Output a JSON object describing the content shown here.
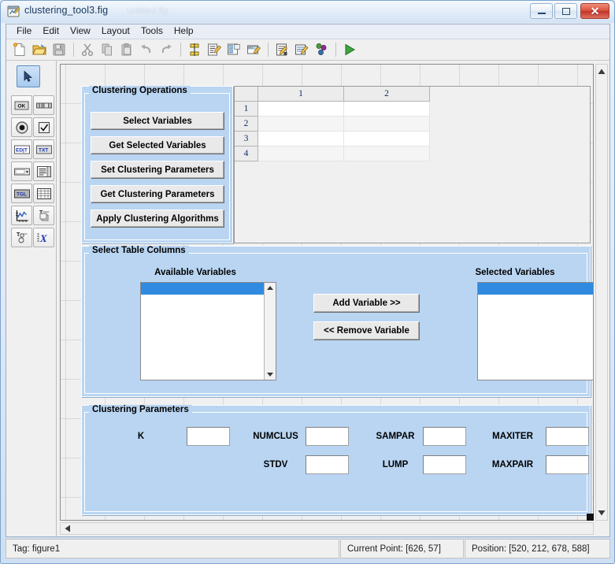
{
  "window": {
    "title": "clustering_tool3.fig",
    "ghost_text": "Untitled.fig",
    "icon": "matlab-figure-icon",
    "buttons": {
      "minimize": "minimize-button",
      "maximize": "maximize-button",
      "close": "✕"
    }
  },
  "menubar": {
    "items": [
      {
        "label": "File"
      },
      {
        "label": "Edit"
      },
      {
        "label": "View"
      },
      {
        "label": "Layout"
      },
      {
        "label": "Tools"
      },
      {
        "label": "Help"
      }
    ]
  },
  "toolbar": {
    "items": [
      {
        "name": "new-figure-icon",
        "title": "New"
      },
      {
        "name": "open-folder-icon",
        "title": "Open"
      },
      {
        "name": "save-icon",
        "title": "Save"
      },
      {
        "name": "separator"
      },
      {
        "name": "cut-scissors-icon",
        "title": "Cut"
      },
      {
        "name": "copy-icon",
        "title": "Copy"
      },
      {
        "name": "paste-icon",
        "title": "Paste"
      },
      {
        "name": "undo-arrow-icon",
        "title": "Undo"
      },
      {
        "name": "redo-arrow-icon",
        "title": "Redo"
      },
      {
        "name": "separator"
      },
      {
        "name": "align-objects-icon",
        "title": "Align Objects"
      },
      {
        "name": "menu-editor-icon",
        "title": "Menu Editor"
      },
      {
        "name": "tab-order-editor-icon",
        "title": "Tab Order Editor"
      },
      {
        "name": "toolbar-editor-icon",
        "title": "Toolbar Editor"
      },
      {
        "name": "separator"
      },
      {
        "name": "m-file-editor-icon",
        "title": "M-file Editor"
      },
      {
        "name": "property-inspector-icon",
        "title": "Property Inspector"
      },
      {
        "name": "object-browser-icon",
        "title": "Object Browser"
      },
      {
        "name": "separator"
      },
      {
        "name": "run-play-icon",
        "title": "Run Figure"
      }
    ]
  },
  "palette": {
    "selected_tool": "select-arrow-tool",
    "tools": [
      {
        "name": "push-button-tool",
        "glyph": "OK"
      },
      {
        "name": "slider-tool",
        "glyph": "slider"
      },
      {
        "name": "radio-button-tool",
        "glyph": "radio"
      },
      {
        "name": "check-box-tool",
        "glyph": "check"
      },
      {
        "name": "edit-text-tool",
        "glyph": "EDIT"
      },
      {
        "name": "static-text-tool",
        "glyph": "TXT"
      },
      {
        "name": "popup-menu-tool",
        "glyph": "popup"
      },
      {
        "name": "listbox-tool",
        "glyph": "listbox"
      },
      {
        "name": "toggle-button-tool",
        "glyph": "TGL"
      },
      {
        "name": "table-tool",
        "glyph": "table"
      },
      {
        "name": "axes-tool",
        "glyph": "axes"
      },
      {
        "name": "panel-tool",
        "glyph": "panel"
      },
      {
        "name": "button-group-tool",
        "glyph": "buttongroup"
      },
      {
        "name": "activex-control-tool",
        "glyph": "X"
      }
    ]
  },
  "canvas": {
    "clustering_operations": {
      "title": "Clustering Operations",
      "buttons": [
        {
          "label": "Select Variables",
          "name": "select-variables-button"
        },
        {
          "label": "Get Selected Variables",
          "name": "get-selected-variables-button"
        },
        {
          "label": "Set Clustering Parameters",
          "name": "set-clustering-parameters-button"
        },
        {
          "label": "Get Clustering Parameters",
          "name": "get-clustering-parameters-button"
        },
        {
          "label": "Apply Clustering Algorithms",
          "name": "apply-clustering-algorithms-button"
        }
      ]
    },
    "table": {
      "column_headers": [
        "1",
        "2"
      ],
      "row_headers": [
        "1",
        "2",
        "3",
        "4"
      ],
      "cells": [
        [
          "",
          ""
        ],
        [
          "",
          ""
        ],
        [
          "",
          ""
        ],
        [
          "",
          ""
        ]
      ]
    },
    "select_table_columns": {
      "title": "Select Table Columns",
      "available_label": "Available Variables",
      "selected_label": "Selected Variables",
      "available_items": [],
      "selected_items": [],
      "add_button": "Add Variable >>",
      "remove_button": "<< Remove Variable"
    },
    "clustering_parameters": {
      "title": "Clustering Parameters",
      "fields": [
        {
          "label": "K",
          "value": "",
          "name": "k-field"
        },
        {
          "label": "NUMCLUS",
          "value": "",
          "name": "numclus-field"
        },
        {
          "label": "SAMPAR",
          "value": "",
          "name": "sampar-field"
        },
        {
          "label": "MAXITER",
          "value": "",
          "name": "maxiter-field"
        },
        {
          "label": "STDV",
          "value": "",
          "name": "stdv-field"
        },
        {
          "label": "LUMP",
          "value": "",
          "name": "lump-field"
        },
        {
          "label": "MAXPAIR",
          "value": "",
          "name": "maxpair-field"
        }
      ]
    }
  },
  "statusbar": {
    "tag": "Tag: figure1",
    "current_point": "Current Point:  [626, 57]",
    "position": "Position: [520, 212, 678, 588]"
  },
  "colors": {
    "panel_blue": "#b9d5f2",
    "selection_blue": "#2f8ae0",
    "titlebar": "#e4eef9",
    "toolbar_bg": "#f0f0f0",
    "canvas_bg": "#f0f0f0"
  }
}
